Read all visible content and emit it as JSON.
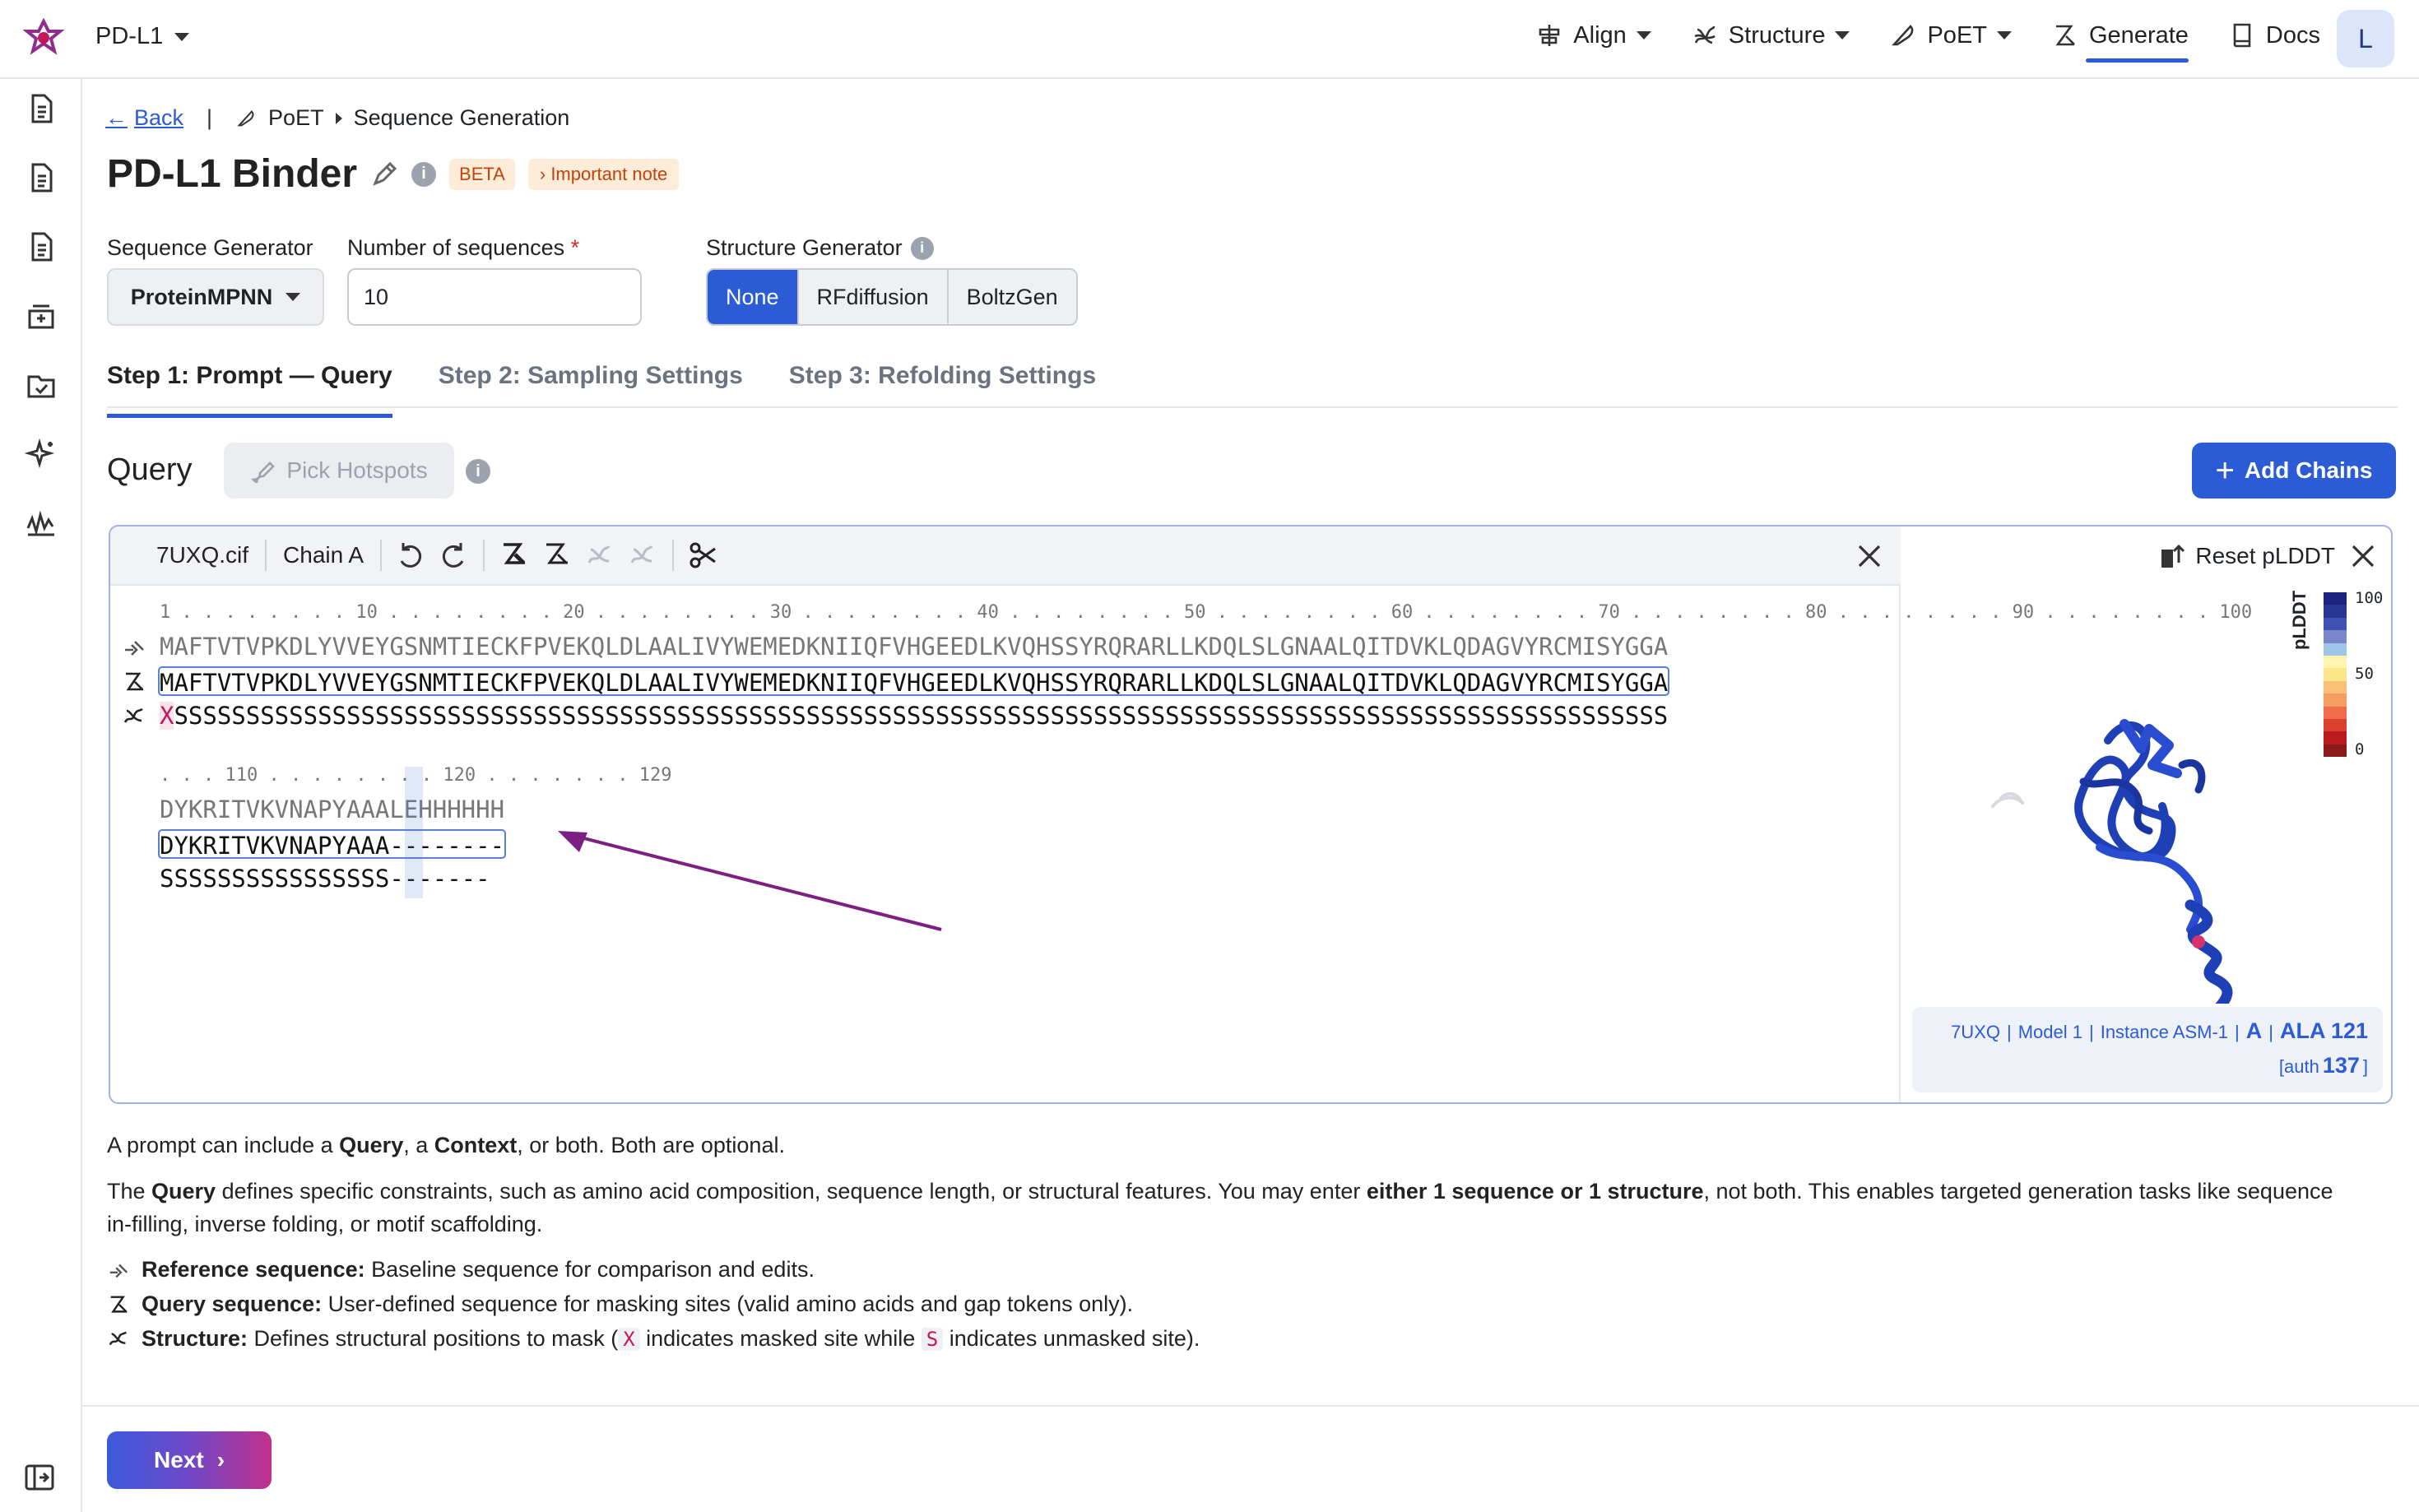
{
  "app": {
    "project": "PD-L1",
    "avatar": "L",
    "nav": [
      {
        "label": "Align",
        "icon": "align-icon",
        "dropdown": true
      },
      {
        "label": "Structure",
        "icon": "structure-icon",
        "dropdown": true
      },
      {
        "label": "PoET",
        "icon": "poet-icon",
        "dropdown": true
      },
      {
        "label": "Generate",
        "icon": "generate-icon",
        "dropdown": false,
        "active": true
      },
      {
        "label": "Docs",
        "icon": "docs-icon",
        "dropdown": false
      }
    ]
  },
  "breadcrumb": {
    "back": "Back",
    "section": "PoET",
    "page": "Sequence Generation"
  },
  "title": {
    "text": "PD-L1 Binder",
    "badge": "BETA",
    "note": "Important note"
  },
  "settings": {
    "seq_gen_label": "Sequence Generator",
    "seq_gen_value": "ProteinMPNN",
    "num_label": "Number of sequences",
    "num_required": "*",
    "num_value": "10",
    "struct_label": "Structure Generator",
    "struct_options": [
      "None",
      "RFdiffusion",
      "BoltzGen"
    ],
    "struct_selected": "None"
  },
  "tabs": [
    "Step 1: Prompt — Query",
    "Step 2: Sampling Settings",
    "Step 3: Refolding Settings"
  ],
  "query": {
    "title": "Query",
    "pick_hotspots": "Pick Hotspots",
    "add_chains": "Add Chains"
  },
  "editor": {
    "file": "7UXQ.cif",
    "chain": "Chain A",
    "block1": {
      "ruler": "1 . . . . . . . . 10 . . . . . . . . 20 . . . . . . . . 30 . . . . . . . . 40 . . . . . . . . 50 . . . . . . . . 60 . . . . . . . . 70 . . . . . . . . 80 . . . . . . . . 90 . . . . . . . . 100",
      "reference": "MAFTVTVPKDLYVVEYGSNMTIECKFPVEKQLDLAALIVYWEMEDKNIIQFVHGEEDLKVQHSSYRQRARLLKDQLSLGNAALQITDVKLQDAGVYRCMISYGGA",
      "query": "MAFTVTVPKDLYVVEYGSNMTIECKFPVEKQLDLAALIVYWEMEDKNIIQFVHGEEDLKVQHSSYRQRARLLKDQLSLGNAALQITDVKLQDAGVYRCMISYGGA",
      "structure_first": "X",
      "structure_rest": "SSSSSSSSSSSSSSSSSSSSSSSSSSSSSSSSSSSSSSSSSSSSSSSSSSSSSSSSSSSSSSSSSSSSSSSSSSSSSSSSSSSSSSSSSSSSSSSSSSSSSSSS"
    },
    "block2": {
      "ruler": ". . . 110 . . . . . . . . 120 . . . . . . . 129",
      "reference": "DYKRITVKVNAPYAAALEHHHHHH",
      "query": "DYKRITVKVNAPYAAA--------",
      "structure": "SSSSSSSSSSSSSSSS-------"
    }
  },
  "viewer": {
    "reset": "Reset pLDDT",
    "legend_title": "pLDDT",
    "legend_ticks": [
      "100",
      "50",
      "0"
    ],
    "legend_colors": [
      "#1a237e",
      "#283593",
      "#3f51b5",
      "#7986cb",
      "#9fc5e8",
      "#fff3b0",
      "#fde68a",
      "#fbbf77",
      "#f59e62",
      "#ef6b4a",
      "#d9412e",
      "#b91c1c",
      "#8b1a1a"
    ],
    "footer_line1": {
      "entry": "7UXQ",
      "model": "Model 1",
      "instance": "Instance ASM-1",
      "chain": "A",
      "residue": "ALA 121"
    },
    "footer_line2": {
      "prefix": "[auth",
      "num": "137",
      "suffix": "]"
    }
  },
  "description": {
    "intro_a": "A prompt can include a ",
    "intro_query": "Query",
    "intro_b": ", a ",
    "intro_context": "Context",
    "intro_c": ", or both. Both are optional.",
    "p2_a": "The ",
    "p2_query": "Query",
    "p2_b": " defines specific constraints, such as amino acid composition, sequence length, or structural features. You may enter ",
    "p2_bold": "either 1 sequence or 1 structure",
    "p2_c": ", not both. This enables targeted generation tasks like sequence",
    "p2_line2": "in-filling, inverse folding, or motif scaffolding.",
    "ref_label": "Reference sequence:",
    "ref_text": " Baseline sequence for comparison and edits.",
    "qry_label": "Query sequence:",
    "qry_text": " User-defined sequence for masking sites (valid amino acids and gap tokens only).",
    "str_label": "Structure:",
    "str_text_a": " Defines structural positions to mask (",
    "str_x": "X",
    "str_text_b": " indicates masked site while ",
    "str_s": "S",
    "str_text_c": " indicates unmasked site)."
  },
  "footer": {
    "next": "Next"
  }
}
